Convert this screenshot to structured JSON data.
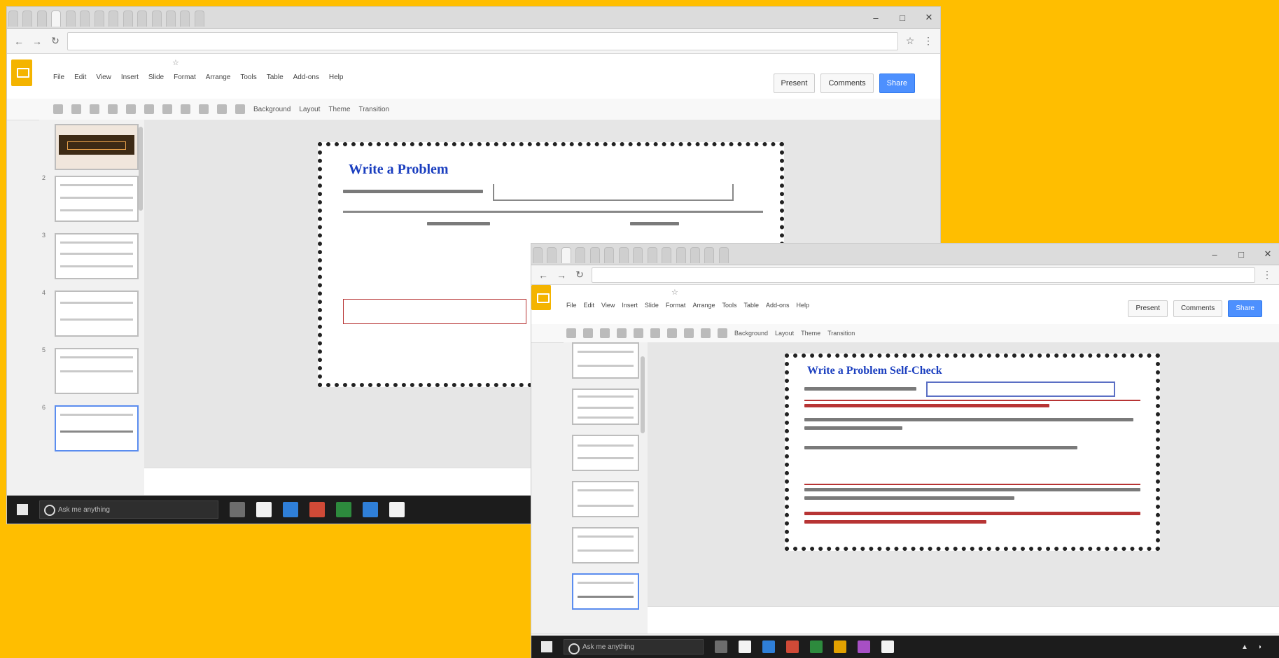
{
  "back_window": {
    "tabs": [
      "",
      "",
      "",
      "",
      "",
      "",
      "",
      "",
      "",
      "",
      "",
      "",
      "",
      ""
    ],
    "url": "",
    "document_title": "",
    "menus": [
      "File",
      "Edit",
      "View",
      "Insert",
      "Slide",
      "Format",
      "Arrange",
      "Tools",
      "Table",
      "Add-ons",
      "Help"
    ],
    "save_status": "",
    "account": "",
    "buttons": {
      "present": "Present",
      "comments": "Comments",
      "share": "Share"
    },
    "toolbar": [
      "Background",
      "Layout",
      "Theme",
      "Transition"
    ],
    "slide_count": 6,
    "slide": {
      "title": "Write a Problem",
      "meta": ""
    },
    "notes": "",
    "download": ""
  },
  "front_window": {
    "tabs": [
      "",
      "",
      "",
      "",
      "",
      "",
      "",
      "",
      "",
      "",
      "",
      "",
      "",
      ""
    ],
    "url": "",
    "document_title": "",
    "menus": [
      "File",
      "Edit",
      "View",
      "Insert",
      "Slide",
      "Format",
      "Arrange",
      "Tools",
      "Table",
      "Add-ons",
      "Help"
    ],
    "save_status": "",
    "account": "",
    "buttons": {
      "present": "Present",
      "comments": "Comments",
      "share": "Share"
    },
    "toolbar": [
      "Background",
      "Layout",
      "Theme",
      "Transition"
    ],
    "slide": {
      "title": "Write a Problem Self-Check"
    },
    "notes": "",
    "download": ""
  },
  "taskbar": {
    "search_placeholder": "Ask me anything",
    "time": ""
  }
}
